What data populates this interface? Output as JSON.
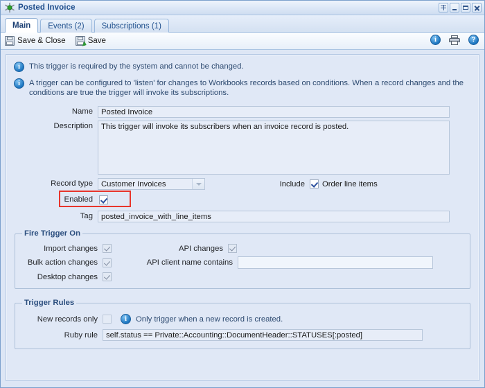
{
  "window": {
    "title": "Posted Invoice",
    "icon": "trigger-gear-icon",
    "buttons": [
      {
        "name": "restore-down-button",
        "glyph": "pin"
      },
      {
        "name": "minimize-button",
        "glyph": "minimize"
      },
      {
        "name": "maximize-button",
        "glyph": "maximize"
      },
      {
        "name": "close-button",
        "glyph": "close"
      }
    ]
  },
  "tabs": [
    {
      "label": "Main",
      "active": true
    },
    {
      "label": "Events (2)",
      "active": false
    },
    {
      "label": "Subscriptions (1)",
      "active": false
    }
  ],
  "toolbar": {
    "save_close_label": "Save & Close",
    "save_label": "Save",
    "info_glyph": "i",
    "help_glyph": "?"
  },
  "notices": [
    "This trigger is required by the system and cannot be changed.",
    "A trigger can be configured to 'listen' for changes to Workbooks records based on conditions. When a record changes and the conditions are true the trigger will invoke its subscriptions."
  ],
  "form": {
    "name_label": "Name",
    "name_value": "Posted Invoice",
    "description_label": "Description",
    "description_value": "This trigger will invoke its subscribers when an invoice record is posted.",
    "record_type_label": "Record type",
    "record_type_value": "Customer Invoices",
    "include_label": "Include",
    "order_line_items_label": "Order line items",
    "order_line_items_checked": true,
    "enabled_label": "Enabled",
    "enabled_checked": true,
    "tag_label": "Tag",
    "tag_value": "posted_invoice_with_line_items"
  },
  "fire_trigger_on": {
    "legend": "Fire Trigger On",
    "import_changes_label": "Import changes",
    "import_changes_checked": true,
    "bulk_action_changes_label": "Bulk action changes",
    "bulk_action_changes_checked": true,
    "desktop_changes_label": "Desktop changes",
    "desktop_changes_checked": true,
    "api_changes_label": "API changes",
    "api_changes_checked": true,
    "api_client_name_label": "API client name contains",
    "api_client_name_value": ""
  },
  "trigger_rules": {
    "legend": "Trigger Rules",
    "new_records_only_label": "New records only",
    "new_records_only_checked": false,
    "new_records_only_hint": "Only trigger when a new record is created.",
    "ruby_rule_label": "Ruby rule",
    "ruby_rule_value": "self.status == Private::Accounting::DocumentHeader::STATUSES[:posted]"
  },
  "annotation": {
    "highlight_color": "#e8352c",
    "highlight_target": "Enabled"
  }
}
